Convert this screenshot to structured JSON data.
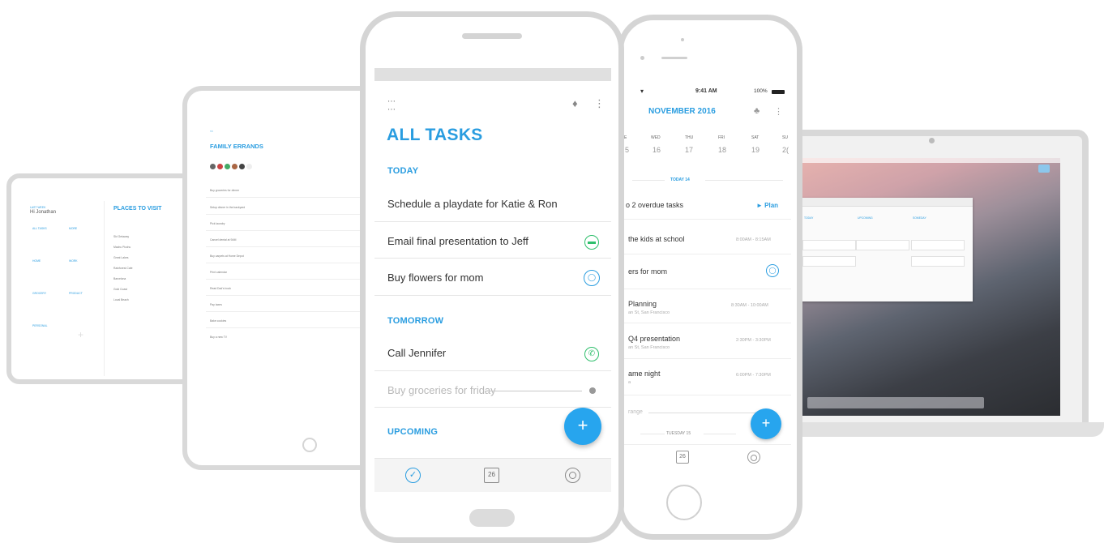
{
  "android": {
    "header_title": "ALL TASKS",
    "sections": [
      {
        "label": "TODAY"
      },
      {
        "label": "TOMORROW"
      },
      {
        "label": "UPCOMING"
      }
    ],
    "tasks": [
      {
        "title": "Schedule a playdate for Katie & Ron",
        "icon": "none"
      },
      {
        "title": "Email final presentation to Jeff",
        "icon": "briefcase-icon"
      },
      {
        "title": "Buy flowers for mom",
        "icon": "target-icon"
      },
      {
        "title": "Call Jennifer",
        "icon": "phone-icon"
      },
      {
        "title": "Buy groceries for friday",
        "icon": "dot-icon",
        "completed": true
      }
    ],
    "nav": {
      "calendar_day": "26"
    },
    "fab_label": "+"
  },
  "iphone": {
    "status_time": "9:41 AM",
    "battery": "100%",
    "month_title": "NOVEMBER 2016",
    "weekdays": [
      {
        "day": "E",
        "date": "5"
      },
      {
        "day": "WED",
        "date": "16"
      },
      {
        "day": "THU",
        "date": "17"
      },
      {
        "day": "FRI",
        "date": "18"
      },
      {
        "day": "SAT",
        "date": "19"
      },
      {
        "day": "SU",
        "date": "2("
      }
    ],
    "today_label": "TODAY 14",
    "overdue_text": "o 2 overdue tasks",
    "plan_label": "► Plan",
    "items": [
      {
        "title": "the kids at school",
        "time": "8:00AM - 8:15AM",
        "sub": ""
      },
      {
        "title": "ers for mom",
        "time": "",
        "sub": ""
      },
      {
        "title": "Planning",
        "time": "8:30AM - 10:00AM",
        "sub": "an St, San Francisco"
      },
      {
        "title": "Q4 presentation",
        "time": "2:30PM - 3:30PM",
        "sub": "an St, San Francisco"
      },
      {
        "title": "ame night",
        "time": "6:00PM - 7:30PM",
        "sub": "a"
      }
    ],
    "struck_item": "range",
    "tuesday_label": "TUESDAY 15",
    "nav": {
      "calendar_day": "26"
    },
    "fab_label": "+"
  },
  "tablet_mid": {
    "back": "<<",
    "title": "FAMILY ERRANDS",
    "rows": [
      "Buy groceries for dinner",
      "Setup dinner in the backyard",
      "Pick laundry",
      "Cancel dental at 9AM",
      "Buy carpets at Home Depot",
      "Print calendar",
      "Read Dad's book",
      "Pay taxes",
      "Bake cookies",
      "Buy a new TV"
    ]
  },
  "tablet_small": {
    "greeting_top": "LAST WEEK",
    "greeting": "Hi Jonathan",
    "title": "PLACES TO VISIT",
    "cells": [
      "ALL TASKS",
      "MORE",
      "HOME",
      "WORK",
      "GROCERY",
      "PRODUCT",
      "PERSONAL"
    ],
    "rows": [
      "Ski Getaway",
      "Machu Picchu",
      "Great Lakes",
      "Rainforest Cafe",
      "Barcelona",
      "Gold Coast",
      "Local Beach"
    ]
  },
  "desktop": {
    "columns": [
      "TODAY",
      "UPCOMING",
      "SOMEDAY"
    ]
  },
  "colors": {
    "accent": "#2a9de0",
    "check_green": "#2fbf6c",
    "text": "#333333",
    "muted": "#aaaaaa"
  }
}
